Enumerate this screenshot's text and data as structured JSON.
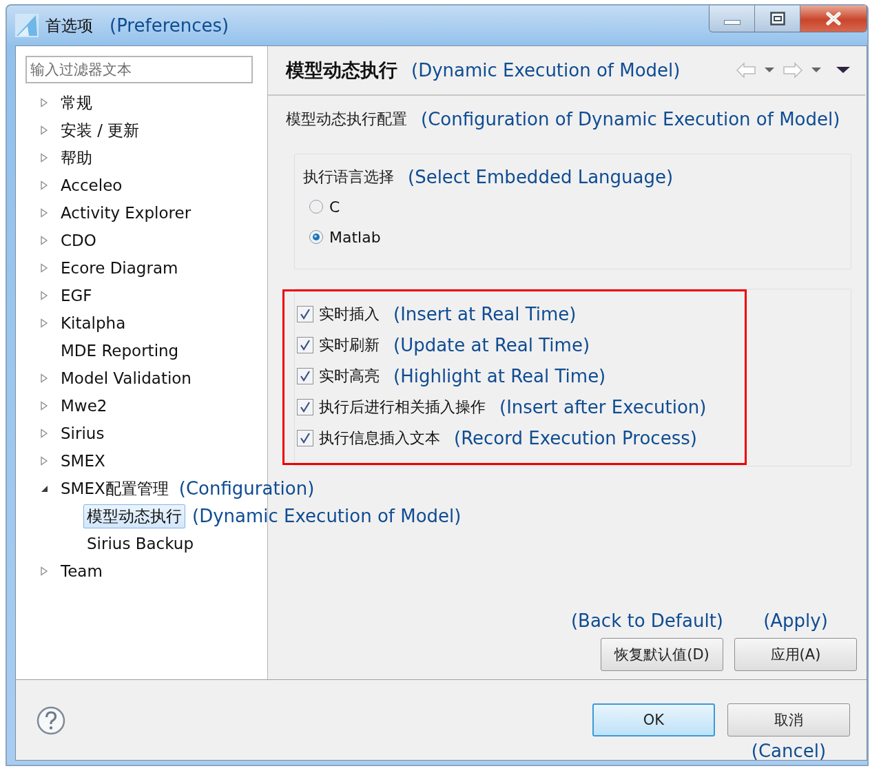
{
  "window": {
    "title": "首选项",
    "title_note": "(Preferences)"
  },
  "filter": {
    "placeholder": "输入过滤器文本"
  },
  "tree": [
    {
      "label": "常规",
      "kind": "folder",
      "expanded": false,
      "selected": false
    },
    {
      "label": "安装 / 更新",
      "kind": "folder",
      "expanded": false,
      "selected": false
    },
    {
      "label": "帮助",
      "kind": "folder",
      "expanded": false,
      "selected": false
    },
    {
      "label": "Acceleo",
      "kind": "folder",
      "expanded": false,
      "selected": false
    },
    {
      "label": "Activity Explorer",
      "kind": "folder",
      "expanded": false,
      "selected": false
    },
    {
      "label": "CDO",
      "kind": "folder",
      "expanded": false,
      "selected": false
    },
    {
      "label": "Ecore Diagram",
      "kind": "folder",
      "expanded": false,
      "selected": false
    },
    {
      "label": "EGF",
      "kind": "folder",
      "expanded": false,
      "selected": false
    },
    {
      "label": "Kitalpha",
      "kind": "folder",
      "expanded": false,
      "selected": false
    },
    {
      "label": "MDE Reporting",
      "kind": "leaf",
      "selected": false
    },
    {
      "label": "Model Validation",
      "kind": "folder",
      "expanded": false,
      "selected": false
    },
    {
      "label": "Mwe2",
      "kind": "folder",
      "expanded": false,
      "selected": false
    },
    {
      "label": "Sirius",
      "kind": "folder",
      "expanded": false,
      "selected": false
    },
    {
      "label": "SMEX",
      "kind": "folder",
      "expanded": false,
      "selected": false
    },
    {
      "label": "SMEX配置管理",
      "note": "(Configuration)",
      "kind": "folder",
      "expanded": true,
      "selected": false,
      "children": [
        {
          "label": "模型动态执行",
          "note": "(Dynamic Execution of Model)",
          "kind": "leaf",
          "selected": true
        },
        {
          "label": "Sirius Backup",
          "kind": "leaf",
          "selected": false
        }
      ]
    },
    {
      "label": "Team",
      "kind": "folder",
      "expanded": false,
      "selected": false
    }
  ],
  "page": {
    "title": "模型动态执行",
    "title_note": "(Dynamic Execution of Model)",
    "section": "模型动态执行配置",
    "section_note": "(Configuration of Dynamic Execution of Model)",
    "language": {
      "label": "执行语言选择",
      "note": "(Select Embedded Language)",
      "options": [
        {
          "label": "C",
          "selected": false
        },
        {
          "label": "Matlab",
          "selected": true
        }
      ]
    },
    "options_highlighted": true,
    "options": [
      {
        "label": "实时插入",
        "note": "(Insert at Real Time)",
        "checked": true
      },
      {
        "label": "实时刷新",
        "note": "(Update at Real Time)",
        "checked": true
      },
      {
        "label": "实时高亮",
        "note": "(Highlight at Real Time)",
        "checked": true
      },
      {
        "label": "执行后进行相关插入操作",
        "note": "(Insert after Execution)",
        "checked": true
      },
      {
        "label": "执行信息插入文本",
        "note": "(Record Execution Process)",
        "checked": true
      }
    ],
    "buttons": [
      {
        "label": "恢复默认值(D)",
        "note": "(Back to Default)"
      },
      {
        "label": "应用(A)",
        "note": "(Apply)"
      }
    ]
  },
  "footer": {
    "buttons": [
      {
        "label": "OK",
        "kind": "default"
      },
      {
        "label": "取消",
        "kind": "normal",
        "note": "(Cancel)"
      }
    ]
  }
}
